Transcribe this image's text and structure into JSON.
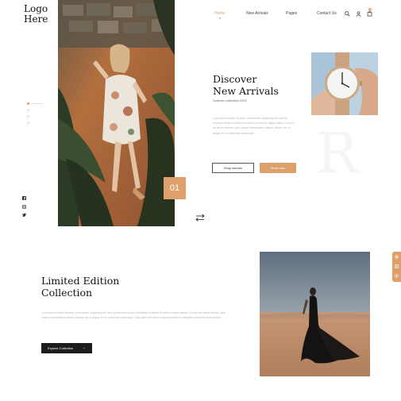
{
  "brand": {
    "logo_line1": "Logo",
    "logo_line2": "Here"
  },
  "nav": {
    "items": [
      {
        "label": "Home",
        "active": true
      },
      {
        "label": "New Arrivals"
      },
      {
        "label": "Pages"
      },
      {
        "label": "Contact Us"
      }
    ],
    "icons": [
      "search-icon",
      "user-icon",
      "cart-icon"
    ],
    "cart_count": "0"
  },
  "hero": {
    "title_line1": "Discover",
    "title_line2": "New Arrivals",
    "subtitle": "Summer collection 2022",
    "body": "Lorem ipsum dolor sit amet, consectetur adipiscing elit, sed do eiusmod tempor incididunt ut labore et dolore magna aliqua. Ut enim ad minim veniam, quis nostrud exercitation ullamco laboris nisi ut aliquip ex ea commodo consequat.",
    "btn_women": "Shop women",
    "btn_men": "Shop men",
    "slide_number": "01",
    "ghost_letter": "R"
  },
  "slider": {
    "dot_count": 4,
    "active_index": 0
  },
  "social": [
    "facebook-icon",
    "instagram-icon",
    "twitter-icon"
  ],
  "collection": {
    "title_line1": "Limited Edition",
    "title_line2": "Collection",
    "body": "Lorem ipsum dolor sit amet, consectetur adipiscing elit, sed do eiusmod tempor incididunt ut labore et dolore magna aliqua. Ut enim ad minim veniam, quis nostrud exercitation ullamco laboris nisi ut aliquip ex ea commodo consequat. Duis aute irure dolor in reprehenderit in voluptate velit esse cillum dolore.",
    "btn_label": "Explore Collection",
    "btn_arrow": "→"
  },
  "colors": {
    "accent": "#dea06b",
    "dark": "#1d1d1d",
    "muted_text": "#b5b5b5"
  }
}
